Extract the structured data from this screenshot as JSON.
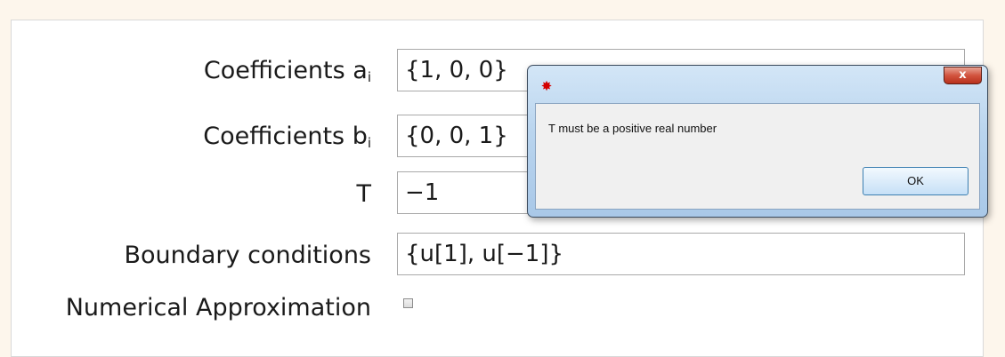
{
  "form": {
    "coefficients_a_label": "Coefficients a",
    "coefficients_a_sub": "i",
    "coefficients_a_value": "{1, 0, 0}",
    "coefficients_b_label": "Coefficients b",
    "coefficients_b_sub": "i",
    "coefficients_b_value": "{0, 0, 1}",
    "t_label": "T",
    "t_value": "−1",
    "boundary_label": "Boundary conditions",
    "boundary_value": "{u[1], u[−1]}",
    "numerical_label": "Numerical Approximation",
    "numerical_checked": false
  },
  "dialog": {
    "icon": "app-icon",
    "close_label": "x",
    "message": "T must be a positive real number",
    "ok_label": "OK"
  },
  "colors": {
    "page_background": "#fdf6ec",
    "close_button": "#c7422a",
    "dialog_frame": "#b9d4ee"
  }
}
